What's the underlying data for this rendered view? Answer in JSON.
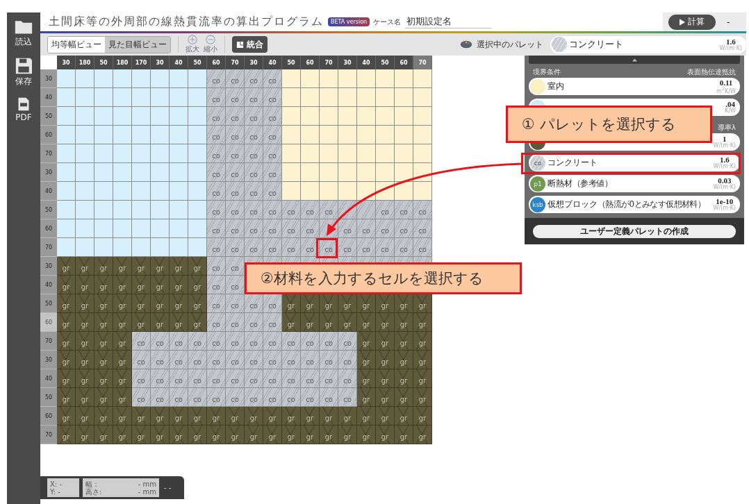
{
  "sidebar": [
    {
      "kind": "folder",
      "label": "読込"
    },
    {
      "kind": "disk",
      "label": "保存"
    },
    {
      "kind": "pdf",
      "label": "PDF"
    }
  ],
  "header": {
    "title": "土間床等の外周部の線熱貫流率の算出プログラム",
    "badge": "BETA version",
    "case_label": "ケース名",
    "case_name": "初期設定名",
    "run_button": "計算",
    "result": "-"
  },
  "toolbar": {
    "view_tabs": [
      {
        "label": "均等幅ビュー",
        "selected": true
      },
      {
        "label": "見た目幅ビュー",
        "selected": false
      }
    ],
    "zoom_buttons": [
      {
        "kind": "plus",
        "label": "拡大"
      },
      {
        "kind": "minus",
        "label": "縮小"
      }
    ],
    "merge_button": "統合",
    "palette_label": "選択中のパレット",
    "current_palette": {
      "kind": "concrete",
      "name": "コンクリート",
      "value": "1.6",
      "unit": "W/(m·K)"
    }
  },
  "grid": {
    "columns": [
      {
        "label": "30",
        "highlighted": false
      },
      {
        "label": "180",
        "highlighted": false
      },
      {
        "label": "50",
        "highlighted": false
      },
      {
        "label": "180",
        "highlighted": false
      },
      {
        "label": "170",
        "highlighted": false
      },
      {
        "label": "30",
        "highlighted": false
      },
      {
        "label": "40",
        "highlighted": false
      },
      {
        "label": "50",
        "highlighted": false
      },
      {
        "label": "60",
        "highlighted": false
      },
      {
        "label": "70",
        "highlighted": false
      },
      {
        "label": "30",
        "highlighted": false
      },
      {
        "label": "40",
        "highlighted": false
      },
      {
        "label": "50",
        "highlighted": false
      },
      {
        "label": "60",
        "highlighted": false
      },
      {
        "label": "70",
        "highlighted": false
      },
      {
        "label": "30",
        "highlighted": false
      },
      {
        "label": "40",
        "highlighted": false
      },
      {
        "label": "50",
        "highlighted": false
      },
      {
        "label": "60",
        "highlighted": false
      },
      {
        "label": "70",
        "highlighted": true
      }
    ],
    "rows": [
      {
        "label": "30",
        "highlighted": false,
        "cells": [
          {
            "kind": "outdoor"
          },
          {
            "kind": "outdoor"
          },
          {
            "kind": "outdoor"
          },
          {
            "kind": "outdoor"
          },
          {
            "kind": "outdoor"
          },
          {
            "kind": "outdoor"
          },
          {
            "kind": "outdoor"
          },
          {
            "kind": "outdoor"
          },
          {
            "kind": "concrete",
            "text": "co"
          },
          {
            "kind": "concrete",
            "text": "co"
          },
          {
            "kind": "concrete",
            "text": "co"
          },
          {
            "kind": "concrete",
            "text": "co"
          },
          {
            "kind": "indoor"
          },
          {
            "kind": "indoor"
          },
          {
            "kind": "indoor"
          },
          {
            "kind": "indoor"
          },
          {
            "kind": "indoor"
          },
          {
            "kind": "indoor"
          },
          {
            "kind": "indoor"
          },
          {
            "kind": "indoor"
          }
        ]
      },
      {
        "label": "40",
        "highlighted": false,
        "cells": [
          {
            "kind": "outdoor"
          },
          {
            "kind": "outdoor"
          },
          {
            "kind": "outdoor"
          },
          {
            "kind": "outdoor"
          },
          {
            "kind": "outdoor"
          },
          {
            "kind": "outdoor"
          },
          {
            "kind": "outdoor"
          },
          {
            "kind": "outdoor"
          },
          {
            "kind": "concrete",
            "text": "co"
          },
          {
            "kind": "concrete",
            "text": "co"
          },
          {
            "kind": "concrete",
            "text": "co"
          },
          {
            "kind": "concrete",
            "text": "co"
          },
          {
            "kind": "indoor"
          },
          {
            "kind": "indoor"
          },
          {
            "kind": "indoor"
          },
          {
            "kind": "indoor"
          },
          {
            "kind": "indoor"
          },
          {
            "kind": "indoor"
          },
          {
            "kind": "indoor"
          },
          {
            "kind": "indoor"
          }
        ]
      },
      {
        "label": "50",
        "highlighted": false,
        "cells": [
          {
            "kind": "outdoor"
          },
          {
            "kind": "outdoor"
          },
          {
            "kind": "outdoor"
          },
          {
            "kind": "outdoor"
          },
          {
            "kind": "outdoor"
          },
          {
            "kind": "outdoor"
          },
          {
            "kind": "outdoor"
          },
          {
            "kind": "outdoor"
          },
          {
            "kind": "concrete",
            "text": "co"
          },
          {
            "kind": "concrete",
            "text": "co"
          },
          {
            "kind": "concrete",
            "text": "co"
          },
          {
            "kind": "concrete",
            "text": "co"
          },
          {
            "kind": "indoor"
          },
          {
            "kind": "indoor"
          },
          {
            "kind": "indoor"
          },
          {
            "kind": "indoor"
          },
          {
            "kind": "indoor"
          },
          {
            "kind": "indoor"
          },
          {
            "kind": "indoor"
          },
          {
            "kind": "indoor"
          }
        ]
      },
      {
        "label": "60",
        "highlighted": false,
        "cells": [
          {
            "kind": "outdoor"
          },
          {
            "kind": "outdoor"
          },
          {
            "kind": "outdoor"
          },
          {
            "kind": "outdoor"
          },
          {
            "kind": "outdoor"
          },
          {
            "kind": "outdoor"
          },
          {
            "kind": "outdoor"
          },
          {
            "kind": "outdoor"
          },
          {
            "kind": "concrete",
            "text": "co"
          },
          {
            "kind": "concrete",
            "text": "co"
          },
          {
            "kind": "concrete",
            "text": "co"
          },
          {
            "kind": "concrete",
            "text": "co"
          },
          {
            "kind": "indoor"
          },
          {
            "kind": "indoor"
          },
          {
            "kind": "indoor"
          },
          {
            "kind": "indoor"
          },
          {
            "kind": "indoor"
          },
          {
            "kind": "indoor"
          },
          {
            "kind": "indoor"
          },
          {
            "kind": "indoor"
          }
        ]
      },
      {
        "label": "70",
        "highlighted": false,
        "cells": [
          {
            "kind": "outdoor"
          },
          {
            "kind": "outdoor"
          },
          {
            "kind": "outdoor"
          },
          {
            "kind": "outdoor"
          },
          {
            "kind": "outdoor"
          },
          {
            "kind": "outdoor"
          },
          {
            "kind": "outdoor"
          },
          {
            "kind": "outdoor"
          },
          {
            "kind": "concrete",
            "text": "co"
          },
          {
            "kind": "concrete",
            "text": "co"
          },
          {
            "kind": "concrete",
            "text": "co"
          },
          {
            "kind": "concrete",
            "text": "co"
          },
          {
            "kind": "indoor"
          },
          {
            "kind": "indoor"
          },
          {
            "kind": "indoor"
          },
          {
            "kind": "indoor"
          },
          {
            "kind": "indoor"
          },
          {
            "kind": "indoor"
          },
          {
            "kind": "indoor"
          },
          {
            "kind": "indoor"
          }
        ]
      },
      {
        "label": "30",
        "highlighted": false,
        "cells": [
          {
            "kind": "outdoor"
          },
          {
            "kind": "outdoor"
          },
          {
            "kind": "outdoor"
          },
          {
            "kind": "outdoor"
          },
          {
            "kind": "outdoor"
          },
          {
            "kind": "outdoor"
          },
          {
            "kind": "outdoor"
          },
          {
            "kind": "outdoor"
          },
          {
            "kind": "concrete",
            "text": "co"
          },
          {
            "kind": "concrete",
            "text": "co"
          },
          {
            "kind": "concrete",
            "text": "co"
          },
          {
            "kind": "concrete",
            "text": "co"
          },
          {
            "kind": "indoor"
          },
          {
            "kind": "indoor"
          },
          {
            "kind": "indoor"
          },
          {
            "kind": "indoor"
          },
          {
            "kind": "indoor"
          },
          {
            "kind": "indoor"
          },
          {
            "kind": "indoor"
          },
          {
            "kind": "indoor"
          }
        ]
      },
      {
        "label": "40",
        "highlighted": false,
        "cells": [
          {
            "kind": "outdoor"
          },
          {
            "kind": "outdoor"
          },
          {
            "kind": "outdoor"
          },
          {
            "kind": "outdoor"
          },
          {
            "kind": "outdoor"
          },
          {
            "kind": "outdoor"
          },
          {
            "kind": "outdoor"
          },
          {
            "kind": "outdoor"
          },
          {
            "kind": "concrete",
            "text": "co"
          },
          {
            "kind": "concrete",
            "text": "co"
          },
          {
            "kind": "concrete",
            "text": "co"
          },
          {
            "kind": "concrete",
            "text": "co"
          },
          {
            "kind": "indoor"
          },
          {
            "kind": "indoor"
          },
          {
            "kind": "indoor"
          },
          {
            "kind": "indoor"
          },
          {
            "kind": "indoor"
          },
          {
            "kind": "indoor"
          },
          {
            "kind": "indoor"
          },
          {
            "kind": "indoor"
          }
        ]
      },
      {
        "label": "50",
        "highlighted": false,
        "cells": [
          {
            "kind": "outdoor"
          },
          {
            "kind": "outdoor"
          },
          {
            "kind": "outdoor"
          },
          {
            "kind": "outdoor"
          },
          {
            "kind": "outdoor"
          },
          {
            "kind": "outdoor"
          },
          {
            "kind": "outdoor"
          },
          {
            "kind": "outdoor"
          },
          {
            "kind": "concrete",
            "text": "co"
          },
          {
            "kind": "concrete",
            "text": "co"
          },
          {
            "kind": "concrete",
            "text": "co"
          },
          {
            "kind": "concrete",
            "text": "co"
          },
          {
            "kind": "concrete",
            "text": "co"
          },
          {
            "kind": "concrete",
            "text": "co"
          },
          {
            "kind": "concrete",
            "text": "co"
          },
          {
            "kind": "concrete"
          },
          {
            "kind": "concrete"
          },
          {
            "kind": "concrete",
            "text": "co"
          },
          {
            "kind": "concrete",
            "text": "co"
          },
          {
            "kind": "concrete",
            "text": "co"
          }
        ]
      },
      {
        "label": "60",
        "highlighted": false,
        "cells": [
          {
            "kind": "outdoor"
          },
          {
            "kind": "outdoor"
          },
          {
            "kind": "outdoor"
          },
          {
            "kind": "outdoor"
          },
          {
            "kind": "outdoor"
          },
          {
            "kind": "outdoor"
          },
          {
            "kind": "outdoor"
          },
          {
            "kind": "outdoor"
          },
          {
            "kind": "concrete",
            "text": "co"
          },
          {
            "kind": "concrete",
            "text": "co"
          },
          {
            "kind": "concrete",
            "text": "co"
          },
          {
            "kind": "concrete",
            "text": "co"
          },
          {
            "kind": "concrete",
            "text": "co"
          },
          {
            "kind": "concrete",
            "text": "co"
          },
          {
            "kind": "concrete"
          },
          {
            "kind": "concrete",
            "text": "co"
          },
          {
            "kind": "concrete",
            "text": "co"
          },
          {
            "kind": "concrete",
            "text": "co"
          },
          {
            "kind": "concrete",
            "text": "co"
          },
          {
            "kind": "concrete",
            "text": "co"
          }
        ]
      },
      {
        "label": "70",
        "highlighted": false,
        "cells": [
          {
            "kind": "outdoor"
          },
          {
            "kind": "outdoor"
          },
          {
            "kind": "outdoor"
          },
          {
            "kind": "outdoor"
          },
          {
            "kind": "outdoor"
          },
          {
            "kind": "outdoor"
          },
          {
            "kind": "outdoor"
          },
          {
            "kind": "outdoor"
          },
          {
            "kind": "concrete",
            "text": "co"
          },
          {
            "kind": "concrete",
            "text": "co"
          },
          {
            "kind": "concrete",
            "text": "co"
          },
          {
            "kind": "concrete",
            "text": "co"
          },
          {
            "kind": "concrete",
            "text": "co"
          },
          {
            "kind": "concrete",
            "text": "co"
          },
          {
            "kind": "concrete",
            "text": "co"
          },
          {
            "kind": "concrete",
            "text": "co"
          },
          {
            "kind": "concrete",
            "text": "co"
          },
          {
            "kind": "concrete",
            "text": "co"
          },
          {
            "kind": "concrete",
            "text": "co"
          },
          {
            "kind": "concrete",
            "text": "co"
          }
        ]
      },
      {
        "label": "30",
        "highlighted": false,
        "cells": [
          {
            "kind": "ground",
            "text": "gr"
          },
          {
            "kind": "ground",
            "text": "gr"
          },
          {
            "kind": "ground",
            "text": "gr"
          },
          {
            "kind": "ground",
            "text": "gr"
          },
          {
            "kind": "ground",
            "text": "gr"
          },
          {
            "kind": "ground",
            "text": "gr"
          },
          {
            "kind": "ground",
            "text": "gr"
          },
          {
            "kind": "ground",
            "text": "gr"
          },
          {
            "kind": "concrete",
            "text": "co"
          },
          {
            "kind": "concrete",
            "text": "co"
          },
          {
            "kind": "concrete"
          },
          {
            "kind": "concrete"
          },
          {
            "kind": "concrete"
          },
          {
            "kind": "concrete"
          },
          {
            "kind": "concrete"
          },
          {
            "kind": "concrete"
          },
          {
            "kind": "concrete"
          },
          {
            "kind": "concrete"
          },
          {
            "kind": "concrete"
          },
          {
            "kind": "concrete"
          }
        ]
      },
      {
        "label": "40",
        "highlighted": false,
        "cells": [
          {
            "kind": "ground",
            "text": "gr"
          },
          {
            "kind": "ground",
            "text": "gr"
          },
          {
            "kind": "ground",
            "text": "gr"
          },
          {
            "kind": "ground",
            "text": "gr"
          },
          {
            "kind": "ground",
            "text": "gr"
          },
          {
            "kind": "ground",
            "text": "gr"
          },
          {
            "kind": "ground",
            "text": "gr"
          },
          {
            "kind": "ground",
            "text": "gr"
          },
          {
            "kind": "concrete",
            "text": "co"
          },
          {
            "kind": "concrete",
            "text": "co"
          }
        ]
      },
      {
        "label": "50",
        "highlighted": false,
        "cells": [
          {
            "kind": "ground",
            "text": "gr"
          },
          {
            "kind": "ground",
            "text": "gr"
          },
          {
            "kind": "ground",
            "text": "gr"
          },
          {
            "kind": "ground",
            "text": "gr"
          },
          {
            "kind": "ground",
            "text": "gr"
          },
          {
            "kind": "ground",
            "text": "gr"
          },
          {
            "kind": "ground",
            "text": "gr"
          },
          {
            "kind": "ground",
            "text": "gr"
          },
          {
            "kind": "concrete",
            "text": "co"
          },
          {
            "kind": "concrete",
            "text": "co"
          },
          {
            "kind": "concrete",
            "text": "co"
          },
          {
            "kind": "concrete",
            "text": "co"
          },
          {
            "kind": "ground",
            "text": "gr"
          },
          {
            "kind": "ground",
            "text": "gr"
          },
          {
            "kind": "ground",
            "text": "gr"
          },
          {
            "kind": "ground",
            "text": "gr"
          },
          {
            "kind": "ground",
            "text": "gr"
          },
          {
            "kind": "ground",
            "text": "gr"
          },
          {
            "kind": "ground",
            "text": "gr"
          },
          {
            "kind": "ground",
            "text": "gr"
          }
        ]
      },
      {
        "label": "60",
        "highlighted": true,
        "cells": [
          {
            "kind": "ground",
            "text": "gr"
          },
          {
            "kind": "ground",
            "text": "gr"
          },
          {
            "kind": "ground",
            "text": "gr"
          },
          {
            "kind": "ground",
            "text": "gr"
          },
          {
            "kind": "ground",
            "text": "gr"
          },
          {
            "kind": "ground",
            "text": "gr"
          },
          {
            "kind": "ground",
            "text": "gr"
          },
          {
            "kind": "ground",
            "text": "gr"
          },
          {
            "kind": "concrete",
            "text": "co"
          },
          {
            "kind": "concrete",
            "text": "co"
          },
          {
            "kind": "concrete",
            "text": "co"
          },
          {
            "kind": "concrete",
            "text": "co"
          },
          {
            "kind": "ground",
            "text": "gr"
          },
          {
            "kind": "ground",
            "text": "gr"
          },
          {
            "kind": "ground",
            "text": "gr"
          },
          {
            "kind": "ground",
            "text": "gr"
          },
          {
            "kind": "ground",
            "text": "gr"
          },
          {
            "kind": "ground",
            "text": "gr"
          },
          {
            "kind": "ground",
            "text": "gr"
          },
          {
            "kind": "ground",
            "text": "gr"
          }
        ]
      },
      {
        "label": "70",
        "highlighted": false,
        "cells": [
          {
            "kind": "ground",
            "text": "gr"
          },
          {
            "kind": "ground",
            "text": "gr"
          },
          {
            "kind": "ground",
            "text": "gr"
          },
          {
            "kind": "ground",
            "text": "gr"
          },
          {
            "kind": "concrete",
            "text": "co"
          },
          {
            "kind": "concrete",
            "text": "co"
          },
          {
            "kind": "concrete",
            "text": "co"
          },
          {
            "kind": "concrete",
            "text": "co"
          },
          {
            "kind": "concrete",
            "text": "co"
          },
          {
            "kind": "concrete",
            "text": "co"
          },
          {
            "kind": "concrete",
            "text": "co"
          },
          {
            "kind": "concrete",
            "text": "co"
          },
          {
            "kind": "concrete",
            "text": "co"
          },
          {
            "kind": "concrete",
            "text": "co"
          },
          {
            "kind": "concrete",
            "text": "co"
          },
          {
            "kind": "concrete",
            "text": "co"
          },
          {
            "kind": "ground",
            "text": "gr"
          },
          {
            "kind": "ground",
            "text": "gr"
          },
          {
            "kind": "ground",
            "text": "gr"
          },
          {
            "kind": "ground",
            "text": "gr"
          }
        ]
      },
      {
        "label": "30",
        "highlighted": false,
        "cells": [
          {
            "kind": "ground",
            "text": "gr"
          },
          {
            "kind": "ground",
            "text": "gr"
          },
          {
            "kind": "ground",
            "text": "gr"
          },
          {
            "kind": "ground",
            "text": "gr"
          },
          {
            "kind": "concrete",
            "text": "co"
          },
          {
            "kind": "concrete",
            "text": "co"
          },
          {
            "kind": "concrete",
            "text": "co"
          },
          {
            "kind": "concrete",
            "text": "co"
          },
          {
            "kind": "concrete",
            "text": "co"
          },
          {
            "kind": "concrete",
            "text": "co"
          },
          {
            "kind": "concrete",
            "text": "co"
          },
          {
            "kind": "concrete",
            "text": "co"
          },
          {
            "kind": "concrete",
            "text": "co"
          },
          {
            "kind": "concrete",
            "text": "co"
          },
          {
            "kind": "concrete",
            "text": "co"
          },
          {
            "kind": "concrete",
            "text": "co"
          },
          {
            "kind": "ground",
            "text": "gr"
          },
          {
            "kind": "ground",
            "text": "gr"
          },
          {
            "kind": "ground",
            "text": "gr"
          },
          {
            "kind": "ground",
            "text": "gr"
          }
        ]
      },
      {
        "label": "40",
        "highlighted": false,
        "cells": [
          {
            "kind": "ground",
            "text": "gr"
          },
          {
            "kind": "ground",
            "text": "gr"
          },
          {
            "kind": "ground",
            "text": "gr"
          },
          {
            "kind": "ground",
            "text": "gr"
          },
          {
            "kind": "concrete",
            "text": "co"
          },
          {
            "kind": "concrete",
            "text": "co"
          },
          {
            "kind": "concrete",
            "text": "co"
          },
          {
            "kind": "concrete",
            "text": "co"
          },
          {
            "kind": "concrete",
            "text": "co"
          },
          {
            "kind": "concrete",
            "text": "co"
          },
          {
            "kind": "concrete",
            "text": "co"
          },
          {
            "kind": "concrete",
            "text": "co"
          },
          {
            "kind": "concrete",
            "text": "co"
          },
          {
            "kind": "concrete",
            "text": "co"
          },
          {
            "kind": "concrete",
            "text": "co"
          },
          {
            "kind": "concrete",
            "text": "co"
          },
          {
            "kind": "ground",
            "text": "gr"
          },
          {
            "kind": "ground",
            "text": "gr"
          },
          {
            "kind": "ground",
            "text": "gr"
          },
          {
            "kind": "ground",
            "text": "gr"
          }
        ]
      },
      {
        "label": "50",
        "highlighted": false,
        "cells": [
          {
            "kind": "ground",
            "text": "gr"
          },
          {
            "kind": "ground",
            "text": "gr"
          },
          {
            "kind": "ground",
            "text": "gr"
          },
          {
            "kind": "ground",
            "text": "gr"
          },
          {
            "kind": "concrete",
            "text": "co"
          },
          {
            "kind": "concrete",
            "text": "co"
          },
          {
            "kind": "concrete",
            "text": "co"
          },
          {
            "kind": "concrete",
            "text": "co"
          },
          {
            "kind": "concrete",
            "text": "co"
          },
          {
            "kind": "concrete",
            "text": "co"
          },
          {
            "kind": "concrete",
            "text": "co"
          },
          {
            "kind": "concrete",
            "text": "co"
          },
          {
            "kind": "concrete",
            "text": "co"
          },
          {
            "kind": "concrete",
            "text": "co"
          },
          {
            "kind": "concrete",
            "text": "co"
          },
          {
            "kind": "concrete",
            "text": "co"
          },
          {
            "kind": "ground",
            "text": "gr"
          },
          {
            "kind": "ground",
            "text": "gr"
          },
          {
            "kind": "ground",
            "text": "gr"
          },
          {
            "kind": "ground",
            "text": "gr"
          }
        ]
      },
      {
        "label": "60",
        "highlighted": false,
        "cells": [
          {
            "kind": "ground",
            "text": "gr"
          },
          {
            "kind": "ground",
            "text": "gr"
          },
          {
            "kind": "ground",
            "text": "gr"
          },
          {
            "kind": "ground",
            "text": "gr"
          },
          {
            "kind": "ground",
            "text": "gr"
          },
          {
            "kind": "ground",
            "text": "gr"
          },
          {
            "kind": "ground",
            "text": "gr"
          },
          {
            "kind": "ground",
            "text": "gr"
          },
          {
            "kind": "ground",
            "text": "gr"
          },
          {
            "kind": "ground",
            "text": "gr"
          },
          {
            "kind": "ground",
            "text": "gr"
          },
          {
            "kind": "ground",
            "text": "gr"
          },
          {
            "kind": "ground",
            "text": "gr"
          },
          {
            "kind": "ground",
            "text": "gr"
          },
          {
            "kind": "ground",
            "text": "gr"
          },
          {
            "kind": "ground",
            "text": "gr"
          },
          {
            "kind": "ground",
            "text": "gr"
          },
          {
            "kind": "ground",
            "text": "gr"
          },
          {
            "kind": "ground",
            "text": "gr"
          },
          {
            "kind": "ground",
            "text": "gr"
          }
        ]
      },
      {
        "label": "70",
        "highlighted": false,
        "cells": [
          {
            "kind": "ground",
            "text": "gr"
          },
          {
            "kind": "ground",
            "text": "gr"
          },
          {
            "kind": "ground",
            "text": "gr"
          },
          {
            "kind": "ground",
            "text": "gr"
          },
          {
            "kind": "ground",
            "text": "gr"
          },
          {
            "kind": "ground",
            "text": "gr"
          },
          {
            "kind": "ground",
            "text": "gr"
          },
          {
            "kind": "ground",
            "text": "gr"
          },
          {
            "kind": "ground",
            "text": "gr"
          },
          {
            "kind": "ground",
            "text": "gr"
          },
          {
            "kind": "ground",
            "text": "gr"
          },
          {
            "kind": "ground",
            "text": "gr"
          },
          {
            "kind": "ground",
            "text": "gr"
          },
          {
            "kind": "ground",
            "text": "gr"
          },
          {
            "kind": "ground",
            "text": "gr"
          },
          {
            "kind": "ground",
            "text": "gr"
          },
          {
            "kind": "ground",
            "text": "gr"
          },
          {
            "kind": "ground",
            "text": "gr"
          },
          {
            "kind": "ground",
            "text": "gr"
          },
          {
            "kind": "ground",
            "text": "gr"
          }
        ]
      }
    ]
  },
  "palette": {
    "sections": [
      {
        "heading": "境界条件",
        "column_heading": "表面熱伝達抵抗",
        "items": [
          {
            "kind": "indoor",
            "name": "室内",
            "value": "0.11",
            "unit": "m$^{2}$K/W"
          },
          {
            "kind": "outdoor",
            "value": ".04",
            "unit": "K/W"
          }
        ]
      },
      {
        "column_heading": "導率λ",
        "items": [
          {
            "kind": "ground",
            "value": "1",
            "unit": "W/(m·K)"
          },
          {
            "kind": "concrete",
            "icon_text": "co",
            "name": "コンクリート",
            "value": "1.6",
            "unit": "W/(m·K)"
          },
          {
            "kind": "insulation",
            "icon_text": "p1",
            "name": "断熱材",
            "note": "（参考値）",
            "value": "0.03",
            "unit": "W/(m·K)"
          },
          {
            "kind": "virtual",
            "icon_text": "ksb",
            "name": "仮想ブロック",
            "note": "（熱流が0とみなす仮想材料）",
            "value": "1e-10",
            "unit": "W/(m·K)"
          }
        ]
      }
    ],
    "create_button": "ユーザー定義パレットの作成"
  },
  "status_bar": {
    "x": "X: -",
    "y": "Y: -",
    "width_label": "幅：",
    "width_value": "- mm",
    "height_label": "高さ:",
    "height_value": "- mm",
    "extra": "- -"
  },
  "callouts": [
    "① パレットを選択する",
    "②材料を入力するセルを選択する"
  ]
}
